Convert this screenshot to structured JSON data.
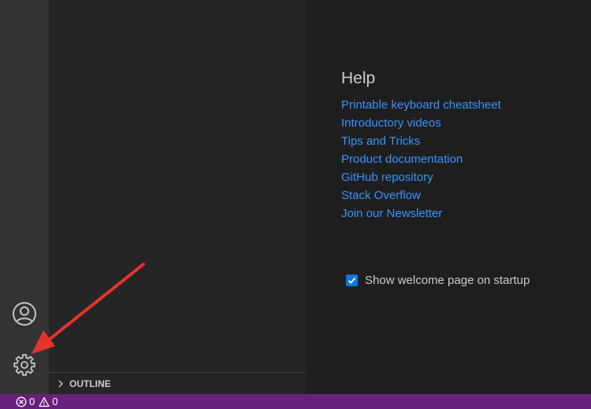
{
  "sidebar": {
    "outline_label": "OUTLINE"
  },
  "help": {
    "title": "Help",
    "links": [
      "Printable keyboard cheatsheet",
      "Introductory videos",
      "Tips and Tricks",
      "Product documentation",
      "GitHub repository",
      "Stack Overflow",
      "Join our Newsletter"
    ]
  },
  "startup": {
    "label": "Show welcome page on startup",
    "checked": true
  },
  "status_bar": {
    "errors": "0",
    "warnings": "0"
  },
  "icons": {
    "accounts": "account-icon",
    "manage": "gear-icon",
    "outline_chevron": "chevron-right-icon",
    "errors": "error-icon",
    "warnings": "warning-icon"
  },
  "colors": {
    "activity_bar": "#333333",
    "side_bar": "#252526",
    "editor": "#1e1e1e",
    "link": "#3794ff",
    "status_bar": "#68217a",
    "checkbox": "#0e78d7",
    "annotation_arrow": "#e8332d"
  }
}
